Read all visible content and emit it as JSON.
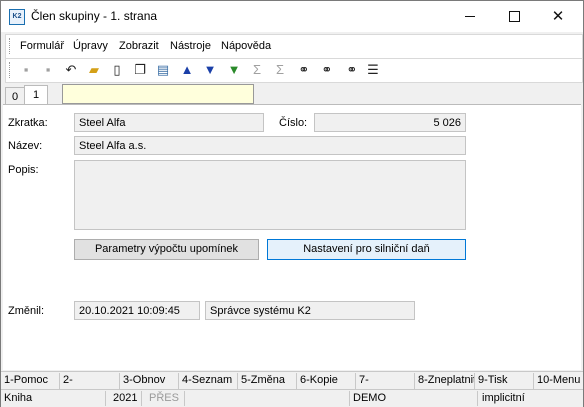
{
  "window": {
    "title": "Člen skupiny - 1. strana",
    "app_icon_text": "K2"
  },
  "menu": [
    "Formulář",
    "Úpravy",
    "Zobrazit",
    "Nástroje",
    "Nápověda"
  ],
  "toolbar_icons": [
    "save-icon",
    "save-as-icon",
    "undo-icon",
    "open-folder-icon",
    "new-document-icon",
    "copy-icon",
    "book-icon",
    "arrow-up-icon",
    "arrow-down-icon",
    "filter-icon",
    "sum-icon",
    "sum-disabled-icon",
    "binoculars-icon",
    "binoculars-next-icon",
    "binoculars-mark-icon",
    "menu-lines-icon"
  ],
  "tabs": [
    {
      "label": "0"
    },
    {
      "label": "1"
    }
  ],
  "form": {
    "zkratka_label": "Zkratka:",
    "zkratka_value": "Steel Alfa",
    "cislo_label": "Číslo:",
    "cislo_value": "5 026",
    "nazev_label": "Název:",
    "nazev_value": "Steel Alfa a.s.",
    "popis_label": "Popis:",
    "popis_value": "",
    "btn_parametry": "Parametry výpočtu upomínek",
    "btn_nastaveni": "Nastavení pro silniční daň",
    "zmenil_label": "Změnil:",
    "zmenil_date": "20.10.2021 10:09:45",
    "zmenil_user": "Správce systému K2"
  },
  "fkeys": [
    "1-Pomoc",
    "2-",
    "3-Obnov",
    "4-Seznam",
    "5-Změna",
    "6-Kopie",
    "7-",
    "8-Zneplatnit",
    "9-Tisk",
    "10-Menu"
  ],
  "status": {
    "s1": "Kniha",
    "s2": "2021",
    "s3": "PŘES",
    "s4": "DEMO",
    "s5": "implicitní"
  }
}
